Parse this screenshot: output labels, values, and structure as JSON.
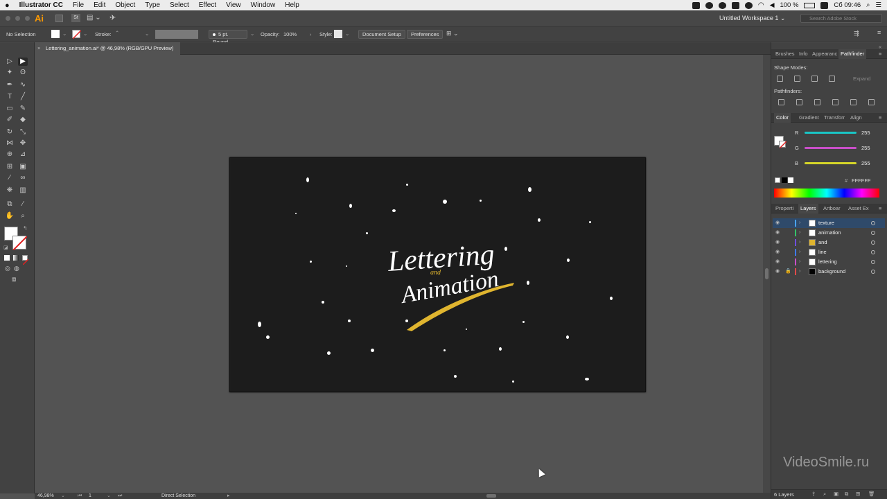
{
  "menubar": {
    "app_name": "Illustrator CC",
    "items": [
      "File",
      "Edit",
      "Object",
      "Type",
      "Select",
      "Effect",
      "View",
      "Window",
      "Help"
    ],
    "battery": "100 %",
    "clock": "Сб 09:46"
  },
  "appbar": {
    "logo": "Ai",
    "st_label": "St",
    "workspace": "Untitled Workspace 1",
    "search_placeholder": "Search Adobe Stock"
  },
  "control_bar": {
    "selection_label": "No Selection",
    "stroke_label": "Stroke:",
    "brush_label": "5 pt. Round",
    "opacity_label": "Opacity:",
    "opacity_value": "100%",
    "style_label": "Style:",
    "document_setup": "Document Setup",
    "preferences": "Preferences"
  },
  "document": {
    "tab_title": "Lettering_animation.ai* @ 46,98% (RGB/GPU Preview)",
    "artwork": {
      "line1": "Lettering",
      "line2": "and",
      "line3": "Animation",
      "accent_color": "#e0b52f"
    }
  },
  "right_panel": {
    "top_tabs": [
      "Brushes",
      "Info",
      "Appearanc",
      "Pathfinder"
    ],
    "shape_modes_label": "Shape Modes:",
    "expand_label": "Expand",
    "pathfinders_label": "Pathfinders:",
    "color_tabs": [
      "Color",
      "Gradient",
      "Transforr",
      "Align"
    ],
    "channels": [
      {
        "label": "R",
        "value": "255",
        "color": "#19c6c6"
      },
      {
        "label": "G",
        "value": "255",
        "color": "#c94fc9"
      },
      {
        "label": "B",
        "value": "255",
        "color": "#d6d629"
      }
    ],
    "hex_value": "FFFFFF",
    "layer_tabs": [
      "Properti",
      "Layers",
      "Artboar",
      "Asset Ex"
    ],
    "layers": [
      {
        "name": "texture",
        "color": "#4aa3ff",
        "selected": true,
        "locked": false
      },
      {
        "name": "animation",
        "color": "#35c46a",
        "selected": false,
        "locked": false
      },
      {
        "name": "and",
        "color": "#6f4fe0",
        "selected": false,
        "locked": false
      },
      {
        "name": "line",
        "color": "#3f7bff",
        "selected": false,
        "locked": false
      },
      {
        "name": "lettering",
        "color": "#c94fc9",
        "selected": false,
        "locked": false
      },
      {
        "name": "background",
        "color": "#e04a4a",
        "selected": false,
        "locked": true
      }
    ],
    "layers_count": "6 Layers"
  },
  "status_bar": {
    "zoom": "46,98%",
    "artboard_number": "1",
    "tool": "Direct Selection"
  },
  "watermark": "VideoSmile.ru"
}
